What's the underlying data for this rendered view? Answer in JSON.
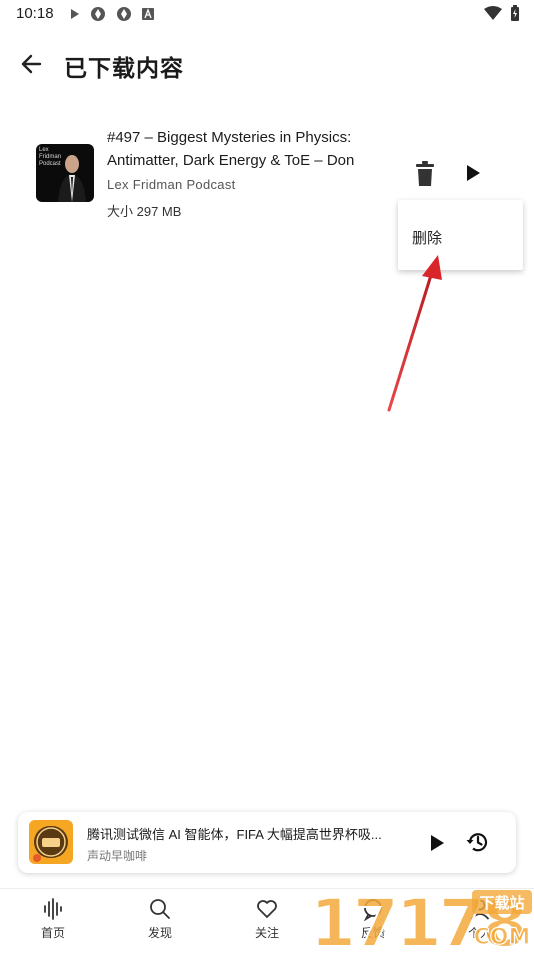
{
  "status_bar": {
    "time": "10:18"
  },
  "header": {
    "title": "已下载内容"
  },
  "episode": {
    "cover_text": "Lex\nFridman\nPodcast",
    "title": "#497 – Biggest Mysteries in Physics: Antimatter, Dark Energy & ToE – Don",
    "podcast": "Lex Fridman Podcast",
    "size": "大小 297 MB"
  },
  "popup_menu": {
    "delete_label": "删除"
  },
  "mini_player": {
    "title": "腾讯测试微信 AI 智能体，FIFA 大幅提高世界杯吸...",
    "subtitle": "声动早咖啡"
  },
  "nav": {
    "items": [
      {
        "label": "首页",
        "icon": "waveform-icon"
      },
      {
        "label": "发现",
        "icon": "search-icon"
      },
      {
        "label": "关注",
        "icon": "heart-icon"
      },
      {
        "label": "反馈",
        "icon": "chat-icon"
      },
      {
        "label": "个人",
        "icon": "person-icon"
      }
    ]
  },
  "watermark": {
    "text": "17178",
    "tag": "下载站",
    "domain": "COM"
  },
  "colors": {
    "arrow": "#d9262a",
    "watermark": "#f2a93b"
  }
}
